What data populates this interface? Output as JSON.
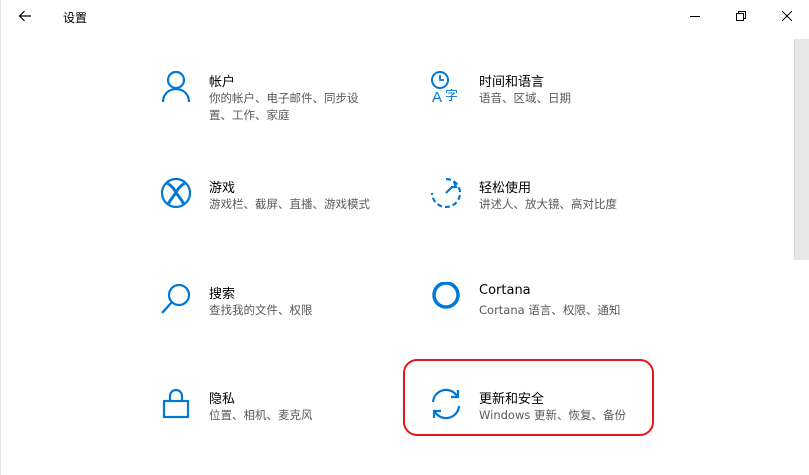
{
  "window": {
    "title": "设置"
  },
  "colors": {
    "accent": "#0078d7",
    "highlight": "#e0181b",
    "desc_text": "#5a5a5a"
  },
  "tiles": [
    {
      "icon": "person-icon",
      "title": "帐户",
      "desc": "你的帐户、电子邮件、同步设置、工作、家庭"
    },
    {
      "icon": "time-language-icon",
      "title": "时间和语言",
      "desc": "语音、区域、日期"
    },
    {
      "icon": "xbox-icon",
      "title": "游戏",
      "desc": "游戏栏、截屏、直播、游戏模式"
    },
    {
      "icon": "ease-of-access-icon",
      "title": "轻松使用",
      "desc": "讲述人、放大镜、高对比度"
    },
    {
      "icon": "search-icon",
      "title": "搜索",
      "desc": "查找我的文件、权限"
    },
    {
      "icon": "cortana-icon",
      "title": "Cortana",
      "desc": "Cortana 语言、权限、通知"
    },
    {
      "icon": "lock-icon",
      "title": "隐私",
      "desc": "位置、相机、麦克风"
    },
    {
      "icon": "sync-icon",
      "title": "更新和安全",
      "desc": "Windows 更新、恢复、备份"
    }
  ]
}
